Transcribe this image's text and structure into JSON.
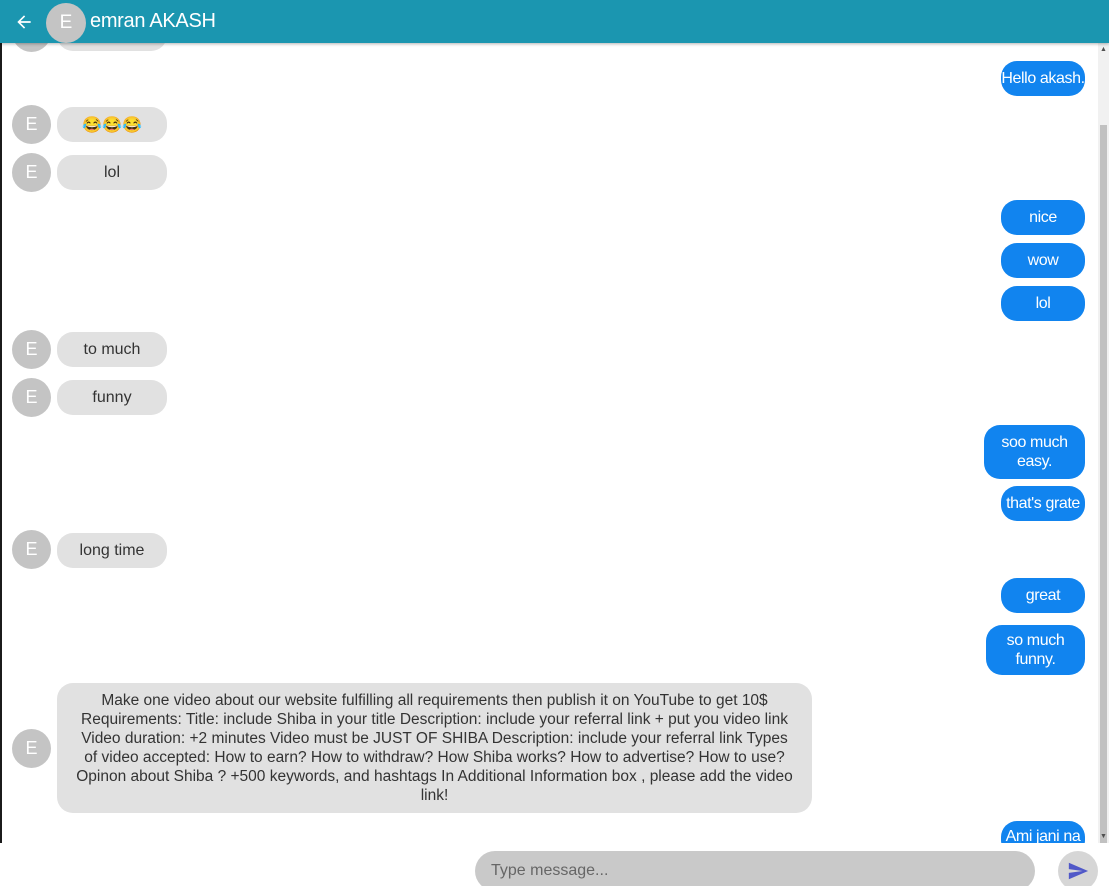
{
  "header": {
    "avatar_initial": "E",
    "contact_name": "emran AKASH"
  },
  "messages": [
    {
      "text": "Hello akash."
    },
    {
      "avatar": "E",
      "text": "😂😂😂"
    },
    {
      "avatar": "E",
      "text": "lol"
    },
    {
      "text": "nice"
    },
    {
      "text": "wow"
    },
    {
      "text": "lol"
    },
    {
      "avatar": "E",
      "text": "to much"
    },
    {
      "avatar": "E",
      "text": "funny"
    },
    {
      "text": "soo much easy."
    },
    {
      "text": "that's grate"
    },
    {
      "avatar": "E",
      "text": "long time"
    },
    {
      "text": "great"
    },
    {
      "text": "so much funny."
    },
    {
      "avatar": "E",
      "text": "Make one video about our website fulfilling all requirements then publish it on YouTube to get 10$ Requirements: Title: include Shiba in your title Description: include your referral link + put you video link Video duration: +2 minutes Video must be JUST OF SHIBA Description: include your referral link Types of video accepted: How to earn? How to withdraw? How Shiba works? How to advertise? How to use? Opinon about Shiba ? +500 keywords, and hashtags In Additional Information box , please add the video link!"
    },
    {
      "text": "Ami jani na"
    }
  ],
  "composer": {
    "placeholder": "Type message..."
  },
  "icons": {
    "back": "arrow-left-icon",
    "send": "send-icon"
  },
  "colors": {
    "header": "#1b96b0",
    "outgoing_bubble": "#1184ef",
    "incoming_bubble": "#e1e1e1",
    "avatar": "#c4c4c4",
    "send_icon": "#5058c8"
  }
}
